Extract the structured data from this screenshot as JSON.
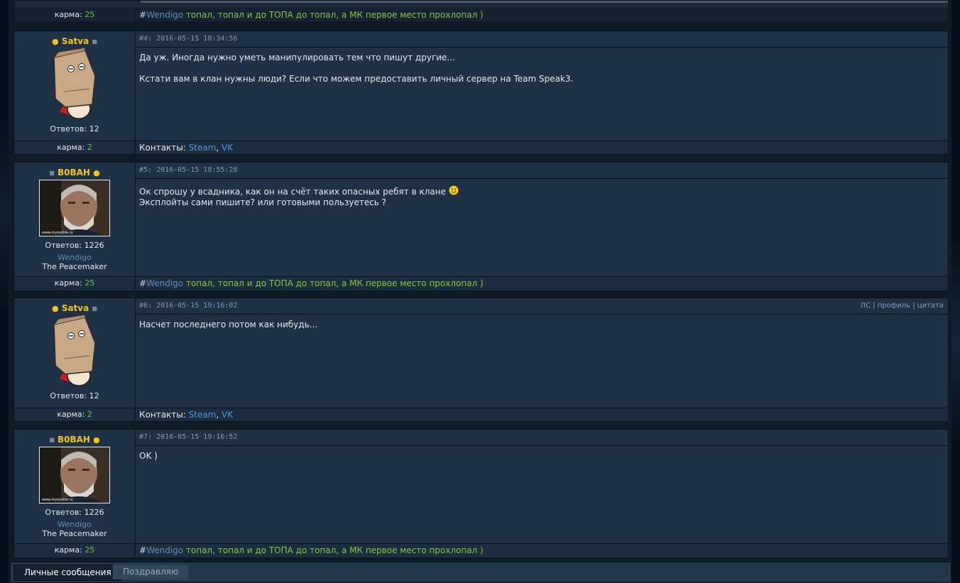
{
  "karma_label": "карма:",
  "answers_label": "Ответов:",
  "contacts_label": "Контакты:",
  "previous_post": {
    "karma": "25",
    "signature": {
      "hash": "#",
      "link": "Wendigo",
      "text": " топал, топал и до ТОПА до топал, а МК первое место прохлопал )"
    }
  },
  "posts": [
    {
      "author": "Satva",
      "meta": "#4: 2016-05-15 18:34:56",
      "lines": [
        "Да уж. Иногда нужно уметь манипулировать тем что пишут другие...",
        "",
        "Кстати вам в клан нужны люди? Если что можем предоставить личный сервер на Team Speak3."
      ],
      "answers": "12",
      "karma": "2",
      "contacts": [
        "Steam",
        "VK"
      ]
    },
    {
      "author": "B0BAH",
      "meta": "#5: 2016-05-15 18:55:28",
      "lines": [
        "Ок спрошу у всадника, как он на счёт таких опасных ребят в клане",
        "Эксплойты сами пишите? или готовыми пользуетесь ?"
      ],
      "emoji": "smile-icon",
      "answers": "1226",
      "clan": "Wendigo",
      "rank": "The Peacemaker",
      "karma": "25",
      "signature": {
        "hash": "#",
        "link": "Wendigo",
        "text": " топал, топал и до ТОПА до топал, а МК первое место прохлопал )"
      }
    },
    {
      "author": "Satva",
      "meta": "#6: 2016-05-15 19:16:02",
      "actions": [
        "ЛС",
        "профиль",
        "цитата"
      ],
      "lines": [
        "Насчет последнего потом как нибудь..."
      ],
      "answers": "12",
      "karma": "2",
      "contacts": [
        "Steam",
        "VK"
      ]
    },
    {
      "author": "B0BAH",
      "meta": "#7: 2016-05-15 19:16:52",
      "lines": [
        "OK )"
      ],
      "answers": "1226",
      "clan": "Wendigo",
      "rank": "The Peacemaker",
      "karma": "25",
      "signature": {
        "hash": "#",
        "link": "Wendigo",
        "text": " топал, топал и до ТОПА до топал, а МК первое место прохлопал )"
      }
    }
  ],
  "avatar_watermark": "www.myrouble.ru",
  "bottom_tabs": [
    "Личные сообщения",
    "Поздравляю"
  ],
  "action_separator": "|",
  "comma": ","
}
